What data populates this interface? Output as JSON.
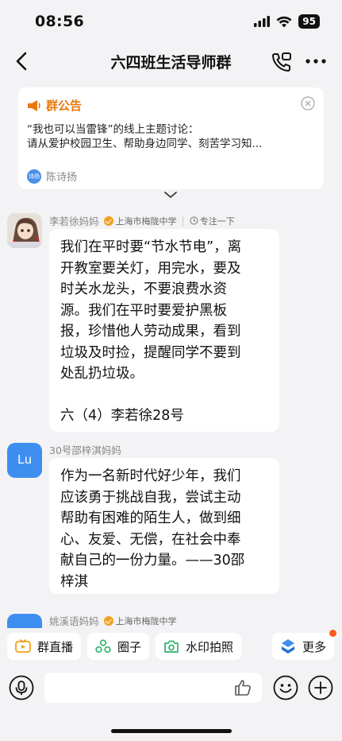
{
  "status": {
    "time": "08:56",
    "battery": "95"
  },
  "header": {
    "title": "六四班生活导师群"
  },
  "notice": {
    "title": "群公告",
    "lines": [
      "“我也可以当雷锋”的线上主题讨论：",
      "请从爱护校园卫生、帮助身边同学、刻苦学习知..."
    ],
    "author_avatar_text": "诗扬",
    "author": "陈诗扬"
  },
  "messages": [
    {
      "sender": "李若徐妈妈",
      "school": "上海市梅陇中学",
      "focus": "专注一下",
      "lines": [
        "我们在平时要“节水节电”，离",
        "开教室要关灯，用完水，要及",
        "时关水龙头，不要浪费水资",
        "源。我们在平时要爱护黑板",
        "报，珍惜他人劳动成果，看到",
        "垃圾及时捡，提醒同学不要到",
        "处乱扔垃圾。",
        "",
        "六（4）李若徐28号"
      ]
    },
    {
      "sender": "30号邵梓淇妈妈",
      "avatar_text": "Lu",
      "lines": [
        "作为一名新时代好少年，我们",
        "应该勇于挑战自我，尝试主动",
        "帮助有困难的陌生人，做到细",
        "心、友爱、无偿，在社会中奉",
        "献自己的一份力量。——30邵",
        "梓淇"
      ]
    },
    {
      "sender": "姚溪语妈妈",
      "school": "上海市梅陇中学"
    }
  ],
  "quick_actions": [
    "群直播",
    "圈子",
    "水印拍照",
    "更多"
  ],
  "colors": {
    "accent": "#e8780c",
    "lu_avatar": "#3e8ef0",
    "live_icon": "#f0a020",
    "circle_icon": "#2fb36e",
    "more_dot": "#ff5a1f"
  }
}
